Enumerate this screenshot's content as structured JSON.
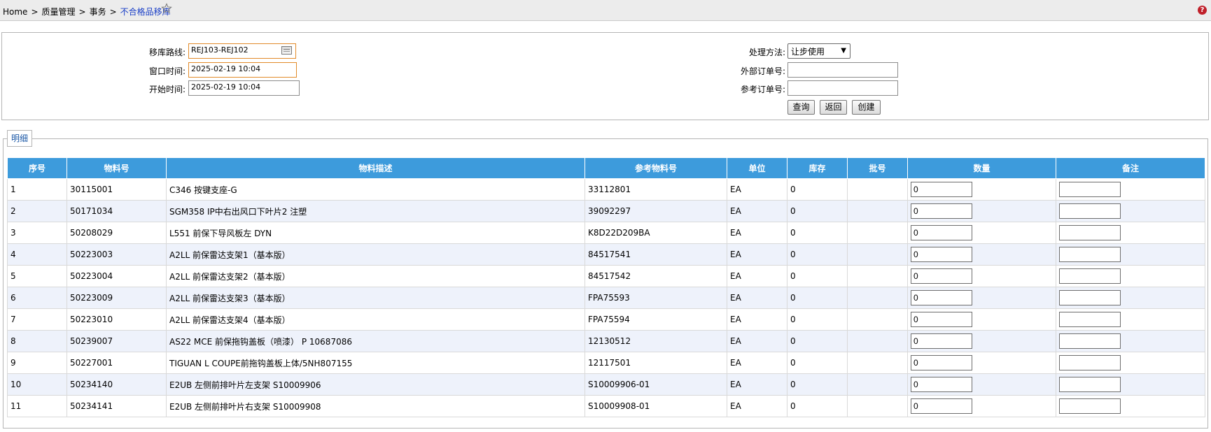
{
  "breadcrumb": {
    "items": [
      "Home",
      "质量管理",
      "事务"
    ],
    "separator": ">",
    "current": "不合格品移库"
  },
  "help": "?",
  "form": {
    "route_label": "移库路线:",
    "route_value": "REJ103-REJ102",
    "window_time_label": "窗口时间:",
    "window_time_value": "2025-02-19 10:04",
    "start_time_label": "开始时间:",
    "start_time_value": "2025-02-19 10:04",
    "method_label": "处理方法:",
    "method_value": "让步使用",
    "external_order_label": "外部订单号:",
    "external_order_value": "",
    "reference_order_label": "参考订单号:",
    "reference_order_value": ""
  },
  "buttons": {
    "query": "查询",
    "back": "返回",
    "create": "创建"
  },
  "detail": {
    "legend": "明细",
    "columns": [
      "序号",
      "物料号",
      "物料描述",
      "参考物料号",
      "单位",
      "库存",
      "批号",
      "数量",
      "备注"
    ],
    "rows": [
      {
        "no": "1",
        "material": "30115001",
        "desc": "C346 按键支座-G",
        "ref": "33112801",
        "unit": "EA",
        "stock": "0",
        "batch": "",
        "qty": "0",
        "remark": ""
      },
      {
        "no": "2",
        "material": "50171034",
        "desc": "SGM358 IP中右出风口下叶片2 注塑",
        "ref": "39092297",
        "unit": "EA",
        "stock": "0",
        "batch": "",
        "qty": "0",
        "remark": ""
      },
      {
        "no": "3",
        "material": "50208029",
        "desc": "L551 前保下导风板左 DYN",
        "ref": "K8D22D209BA",
        "unit": "EA",
        "stock": "0",
        "batch": "",
        "qty": "0",
        "remark": ""
      },
      {
        "no": "4",
        "material": "50223003",
        "desc": "A2LL 前保雷达支架1（基本版）",
        "ref": "84517541",
        "unit": "EA",
        "stock": "0",
        "batch": "",
        "qty": "0",
        "remark": ""
      },
      {
        "no": "5",
        "material": "50223004",
        "desc": "A2LL 前保雷达支架2（基本版）",
        "ref": "84517542",
        "unit": "EA",
        "stock": "0",
        "batch": "",
        "qty": "0",
        "remark": ""
      },
      {
        "no": "6",
        "material": "50223009",
        "desc": "A2LL 前保雷达支架3（基本版）",
        "ref": "FPA75593",
        "unit": "EA",
        "stock": "0",
        "batch": "",
        "qty": "0",
        "remark": ""
      },
      {
        "no": "7",
        "material": "50223010",
        "desc": "A2LL 前保雷达支架4（基本版）",
        "ref": "FPA75594",
        "unit": "EA",
        "stock": "0",
        "batch": "",
        "qty": "0",
        "remark": ""
      },
      {
        "no": "8",
        "material": "50239007",
        "desc": "AS22 MCE 前保拖钩盖板（喷漆） P 10687086",
        "ref": "12130512",
        "unit": "EA",
        "stock": "0",
        "batch": "",
        "qty": "0",
        "remark": ""
      },
      {
        "no": "9",
        "material": "50227001",
        "desc": "TIGUAN L COUPE前拖钩盖板上体/5NH807155",
        "ref": "12117501",
        "unit": "EA",
        "stock": "0",
        "batch": "",
        "qty": "0",
        "remark": ""
      },
      {
        "no": "10",
        "material": "50234140",
        "desc": "E2UB 左侧前排叶片左支架 S10009906",
        "ref": "S10009906-01",
        "unit": "EA",
        "stock": "0",
        "batch": "",
        "qty": "0",
        "remark": ""
      },
      {
        "no": "11",
        "material": "50234141",
        "desc": "E2UB 左侧前排叶片右支架 S10009908",
        "ref": "S10009908-01",
        "unit": "EA",
        "stock": "0",
        "batch": "",
        "qty": "0",
        "remark": ""
      }
    ]
  },
  "colors": {
    "header_bg": "#3d9bdc",
    "alt_row_bg": "#eef2fb",
    "link": "#1a3fc7",
    "focus_border": "#e28b2a"
  }
}
